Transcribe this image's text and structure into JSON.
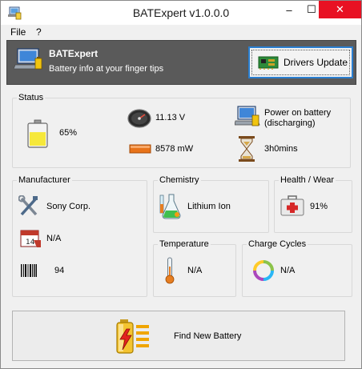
{
  "window": {
    "title": "BATExpert v1.0.0.0"
  },
  "titlebar_buttons": {
    "minimize": "–",
    "maximize": "☐",
    "close": "✕"
  },
  "menu": [
    "File",
    "?"
  ],
  "header": {
    "title": "BATExpert",
    "subtitle": "Battery info at your finger tips",
    "drivers_button_label": "Drivers Update"
  },
  "status": {
    "label": "Status",
    "charge_percent": "65%",
    "voltage": "11.13 V",
    "power": "8578 mW",
    "power_source": "Power on battery\n(discharging)",
    "power_source_line1": "Power on battery",
    "power_source_line2": "(discharging)",
    "time_remaining": "3h0mins",
    "charge_level": 0.65
  },
  "manufacturer": {
    "label": "Manufacturer",
    "name": "Sony Corp.",
    "date": "N/A",
    "serial": "94"
  },
  "chemistry": {
    "label": "Chemistry",
    "value": "Lithium Ion"
  },
  "health": {
    "label": "Health / Wear",
    "value": "91%"
  },
  "temperature": {
    "label": "Temperature",
    "value": "N/A"
  },
  "cycles": {
    "label": "Charge Cycles",
    "value": "N/A"
  },
  "find_button_label": "Find New Battery",
  "icons": {
    "app": "laptop-battery-icon",
    "header": "laptop-icon",
    "drivers": "circuit-board-icon",
    "battery": "battery-icon",
    "gauge": "speedometer-icon",
    "power": "power-bar-icon",
    "laptop_status": "laptop-icon",
    "hourglass": "hourglass-icon",
    "tools": "tools-icon",
    "calendar": "calendar-icon",
    "barcode": "barcode-icon",
    "chemistry": "flask-icon",
    "health": "first-aid-kit-icon",
    "thermometer": "thermometer-icon",
    "cycle": "cycle-arrows-icon",
    "battery_bolt": "battery-bolt-icon"
  },
  "colors": {
    "header_bg": "#5a5a5a",
    "close_button": "#e81123",
    "focus_border": "#2a7fd1",
    "battery_fill": "#f6e83a"
  }
}
